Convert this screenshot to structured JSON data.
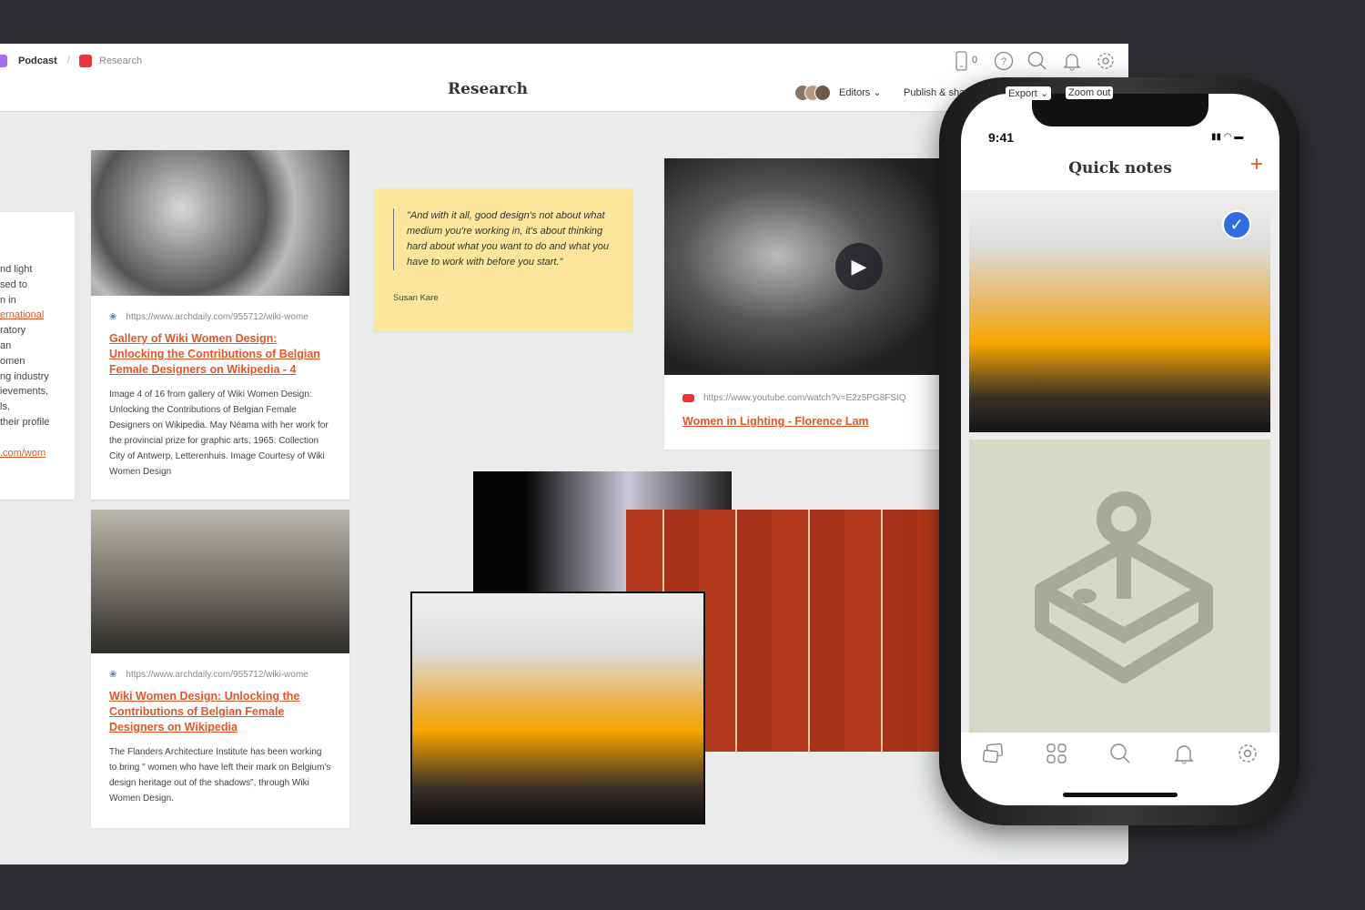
{
  "breadcrumb": [
    {
      "label": "Podcast",
      "color": "#a66ef0"
    },
    {
      "label": "Research",
      "color": "#e8383d"
    }
  ],
  "board": {
    "title": "Research"
  },
  "toolbar": {
    "device_count": "0",
    "editors": "Editors",
    "publish": "Publish & share",
    "export": "Export",
    "zoom": "Zoom out"
  },
  "left_card": {
    "lines": [
      "nd light",
      "sed to",
      "n in",
      "ernational",
      "ratory",
      "an",
      "omen",
      "ng industry",
      "ievements,",
      "ls,",
      "their profile"
    ],
    "url": ".com/wom"
  },
  "card1": {
    "url": "https://www.archdaily.com/955712/wiki-wome",
    "title": "Gallery of Wiki Women Design: Unlocking the Contributions of Belgian Female Designers on Wikipedia - 4",
    "desc": "Image 4 of 16 from gallery of Wiki Women Design: Unlocking the Contributions of Belgian Female Designers on Wikipedia. May Néama with her work for the provincial prize for graphic arts, 1965. Collection City of Antwerp, Letterenhuis. Image Courtesy of Wiki Women Design"
  },
  "card2": {
    "url": "https://www.archdaily.com/955712/wiki-wome",
    "title": "Wiki Women Design: Unlocking the Contributions of Belgian Female Designers on Wikipedia",
    "desc": "The Flanders Architecture Institute has been working to bring \" women who have left their mark on Belgium's design heritage out of the shadows\", through Wiki Women Design."
  },
  "quote": {
    "text": "\"And with it all, good design's not about what medium you're working in, it's about thinking hard about what you want to do and what you have to work with before you start.\"",
    "author": "Susan Kare"
  },
  "video": {
    "url": "https://www.youtube.com/watch?v=E2z5PG8FStQ",
    "title": "Women in Lighting - Florence Lam"
  },
  "phone": {
    "time": "9:41",
    "title": "Quick notes",
    "tabs": [
      "boards-icon",
      "grid-icon",
      "search-icon",
      "bell-icon",
      "gear-icon"
    ]
  },
  "colors": {
    "accent": "#e2572a",
    "quote_bg": "#fde69b",
    "check": "#2f6de1"
  }
}
